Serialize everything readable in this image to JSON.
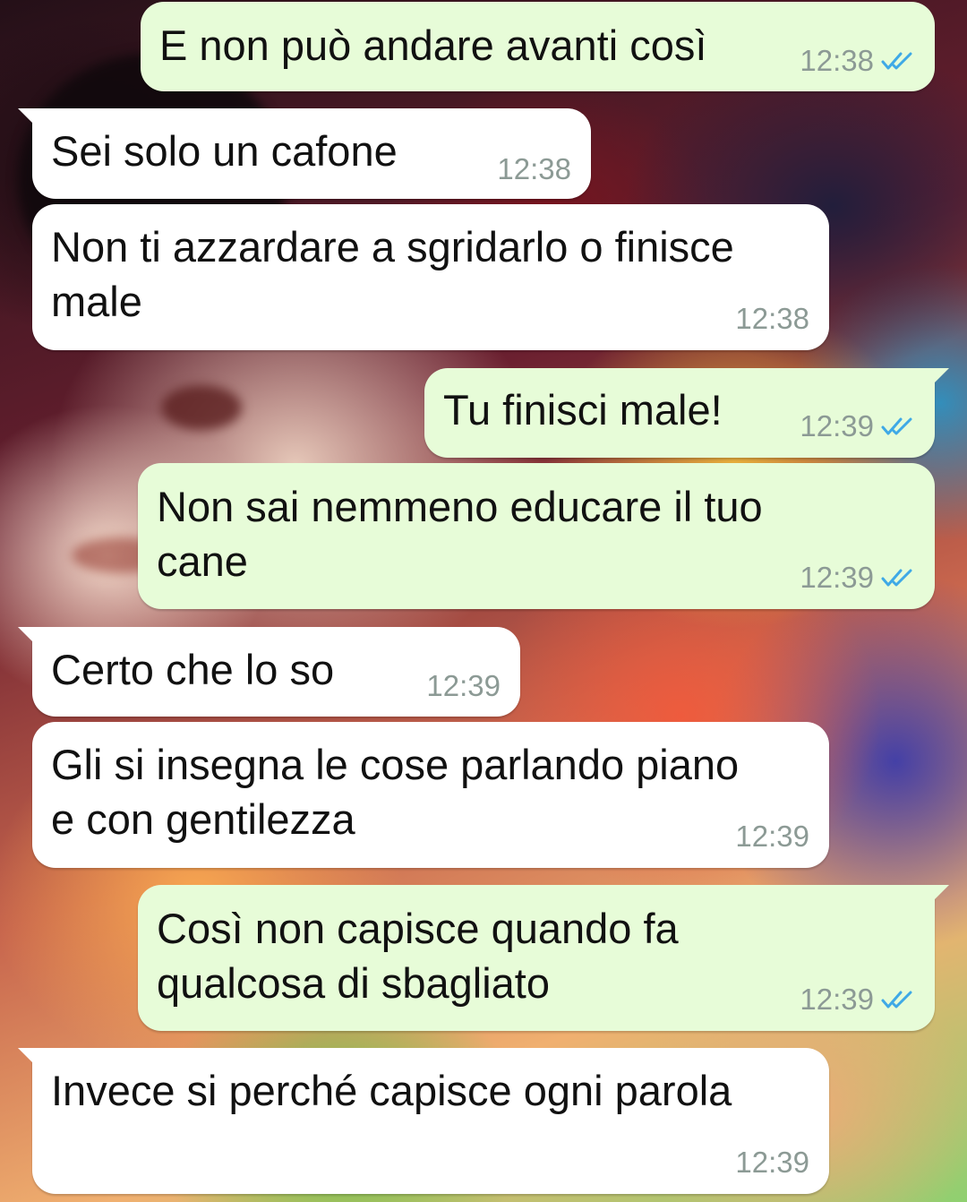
{
  "colors": {
    "incoming_bubble": "#ffffff",
    "outgoing_bubble": "#e7fcd8",
    "message_text": "#111111",
    "timestamp": "#8c9a95",
    "read_ticks": "#3fa9e6"
  },
  "icons": {
    "read_receipt": "double-check-icon"
  },
  "messages": [
    {
      "direction": "outgoing",
      "text": "E non può andare avanti così",
      "time": "12:38",
      "status": "read"
    },
    {
      "direction": "incoming",
      "text": "Sei solo un cafone",
      "time": "12:38"
    },
    {
      "direction": "incoming",
      "text": "Non ti azzardare a sgridarlo o finisce\nmale",
      "time": "12:38"
    },
    {
      "direction": "outgoing",
      "text": "Tu finisci male!",
      "time": "12:39",
      "status": "read"
    },
    {
      "direction": "outgoing",
      "text": "Non sai nemmeno educare il tuo\ncane",
      "time": "12:39",
      "status": "read"
    },
    {
      "direction": "incoming",
      "text": "Certo che lo so",
      "time": "12:39"
    },
    {
      "direction": "incoming",
      "text": "Gli si insegna le cose parlando piano\ne con gentilezza",
      "time": "12:39"
    },
    {
      "direction": "outgoing",
      "text": "Così non capisce quando fa\nqualcosa di sbagliato",
      "time": "12:39",
      "status": "read"
    },
    {
      "direction": "incoming",
      "text": "Invece si perché capisce ogni parola",
      "time": "12:39"
    }
  ]
}
